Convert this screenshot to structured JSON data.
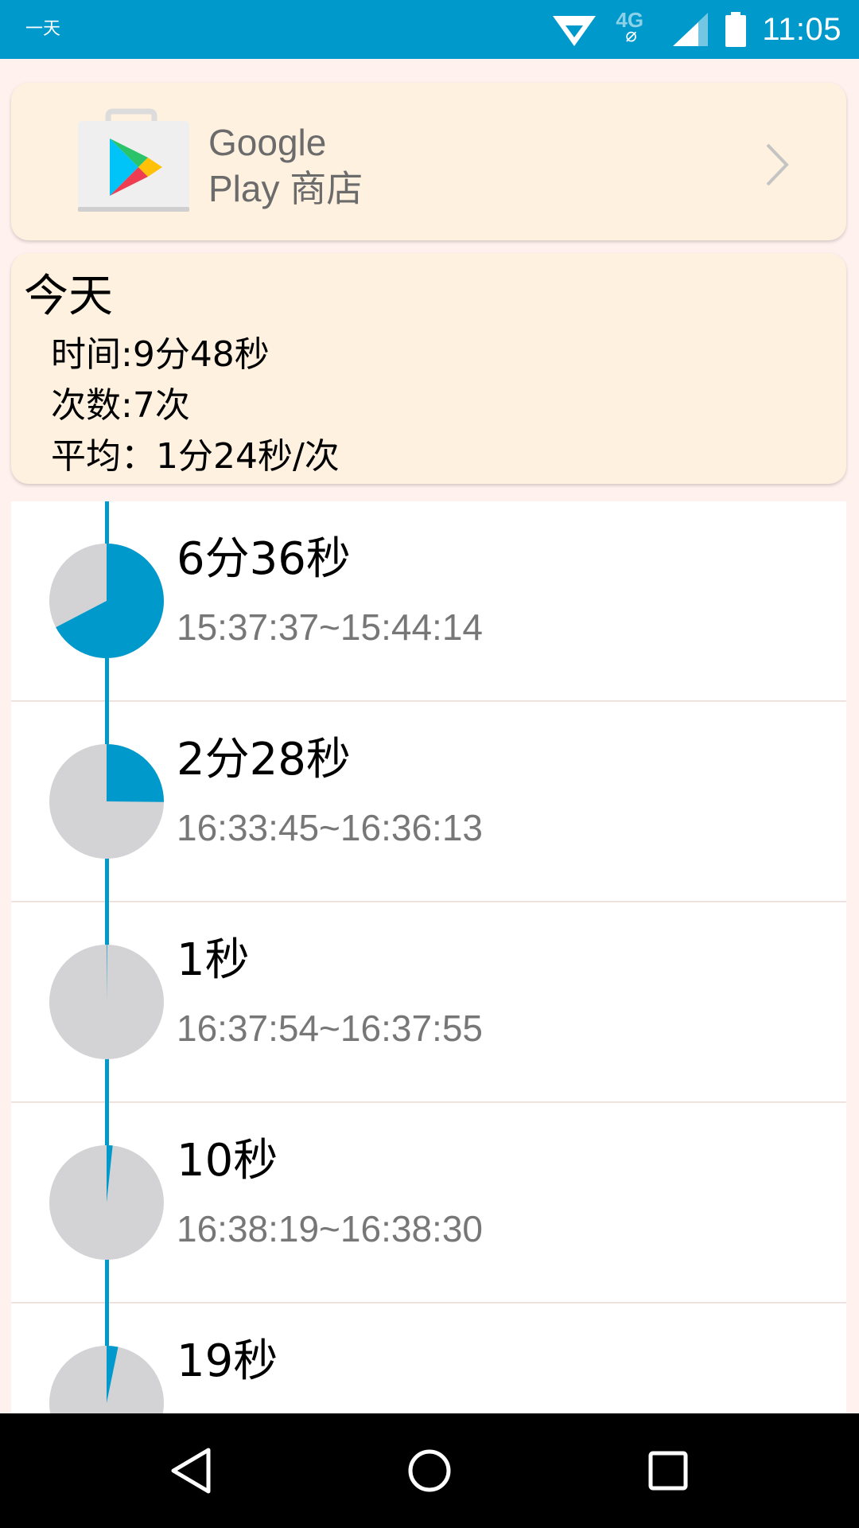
{
  "status_bar": {
    "left_label": "一天",
    "network": "4G",
    "time": "11:05",
    "color": "#0099cc"
  },
  "app_card": {
    "name_line1": "Google",
    "name_line2": "Play 商店",
    "icon": "google-play-store-icon"
  },
  "summary": {
    "title": "今天",
    "total_time": "时间:9分48秒",
    "count": "次数:7次",
    "average": "平均：1分24秒/次"
  },
  "sessions": [
    {
      "duration": "6分36秒",
      "range": "15:37:37~15:44:14",
      "fraction": 0.6735
    },
    {
      "duration": "2分28秒",
      "range": "16:33:45~16:36:13",
      "fraction": 0.2517
    },
    {
      "duration": "1秒",
      "range": "16:37:54~16:37:55",
      "fraction": 0.0017
    },
    {
      "duration": "10秒",
      "range": "16:38:19~16:38:30",
      "fraction": 0.017
    },
    {
      "duration": "19秒",
      "range": "",
      "fraction": 0.0323
    }
  ],
  "colors": {
    "accent": "#0099cc",
    "pie_background": "#d3d3d5",
    "card_background": "#fff1e0"
  },
  "nav": {
    "back_icon": "back-triangle-icon",
    "home_icon": "home-circle-icon",
    "recent_icon": "recent-apps-square-icon"
  }
}
